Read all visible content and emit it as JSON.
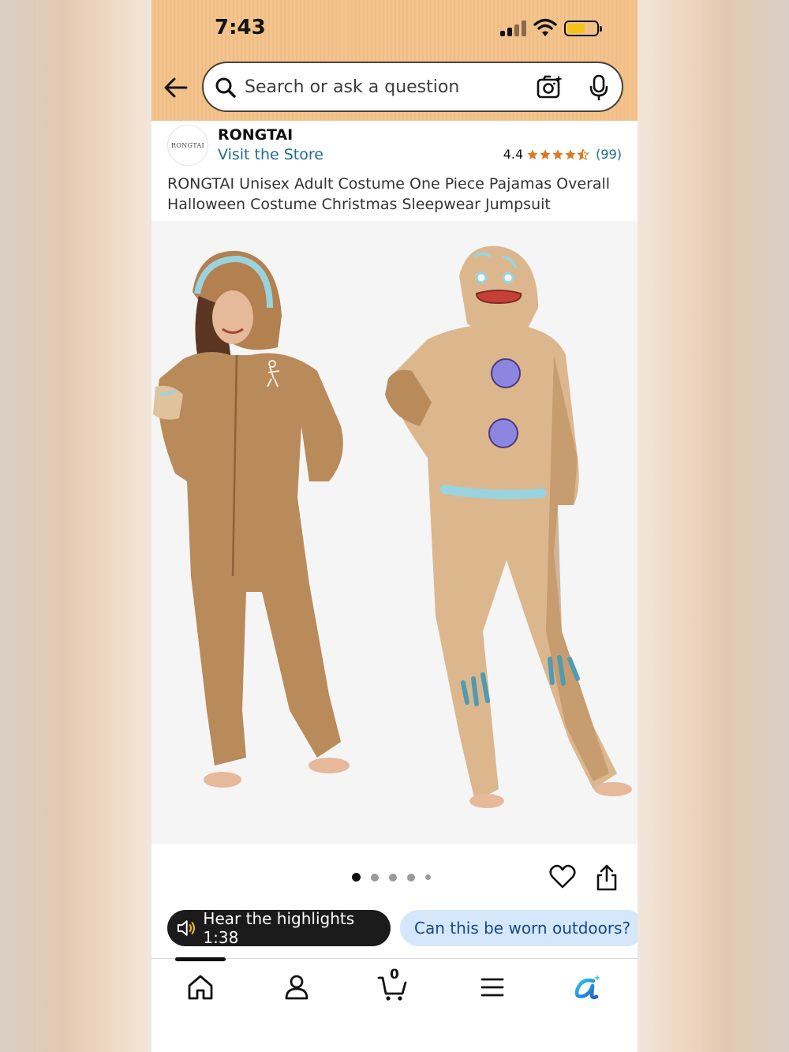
{
  "status_bar": {
    "time": "7:43"
  },
  "search": {
    "placeholder": "Search or ask a question"
  },
  "brand": {
    "logo_text": "RONGTAI",
    "name": "RONGTAI",
    "visit_store": "Visit the Store"
  },
  "rating": {
    "value": "4.4",
    "stars": 4.4,
    "count": "(99)"
  },
  "product": {
    "title": "RONGTAI Unisex Adult Costume One Piece Pajamas Overall Halloween Costume Christmas Sleepwear Jumpsuit"
  },
  "carousel": {
    "total_dots": 5,
    "active_index": 0
  },
  "highlights": {
    "label": "Hear the highlights 1:38"
  },
  "question_chip": {
    "label": "Can this be worn outdoors?"
  },
  "bottom_nav": {
    "items": [
      "home-icon",
      "account-icon",
      "cart-icon",
      "menu-icon",
      "rufus-icon"
    ],
    "cart_count": "0"
  },
  "colors": {
    "header_orange": "#f3c48e",
    "link_blue": "#1f6e8c",
    "star_orange": "#de7921",
    "chip_blue_bg": "#d5e7fb",
    "costume_brown": "#b98a5a",
    "costume_tan": "#dcb78d"
  }
}
